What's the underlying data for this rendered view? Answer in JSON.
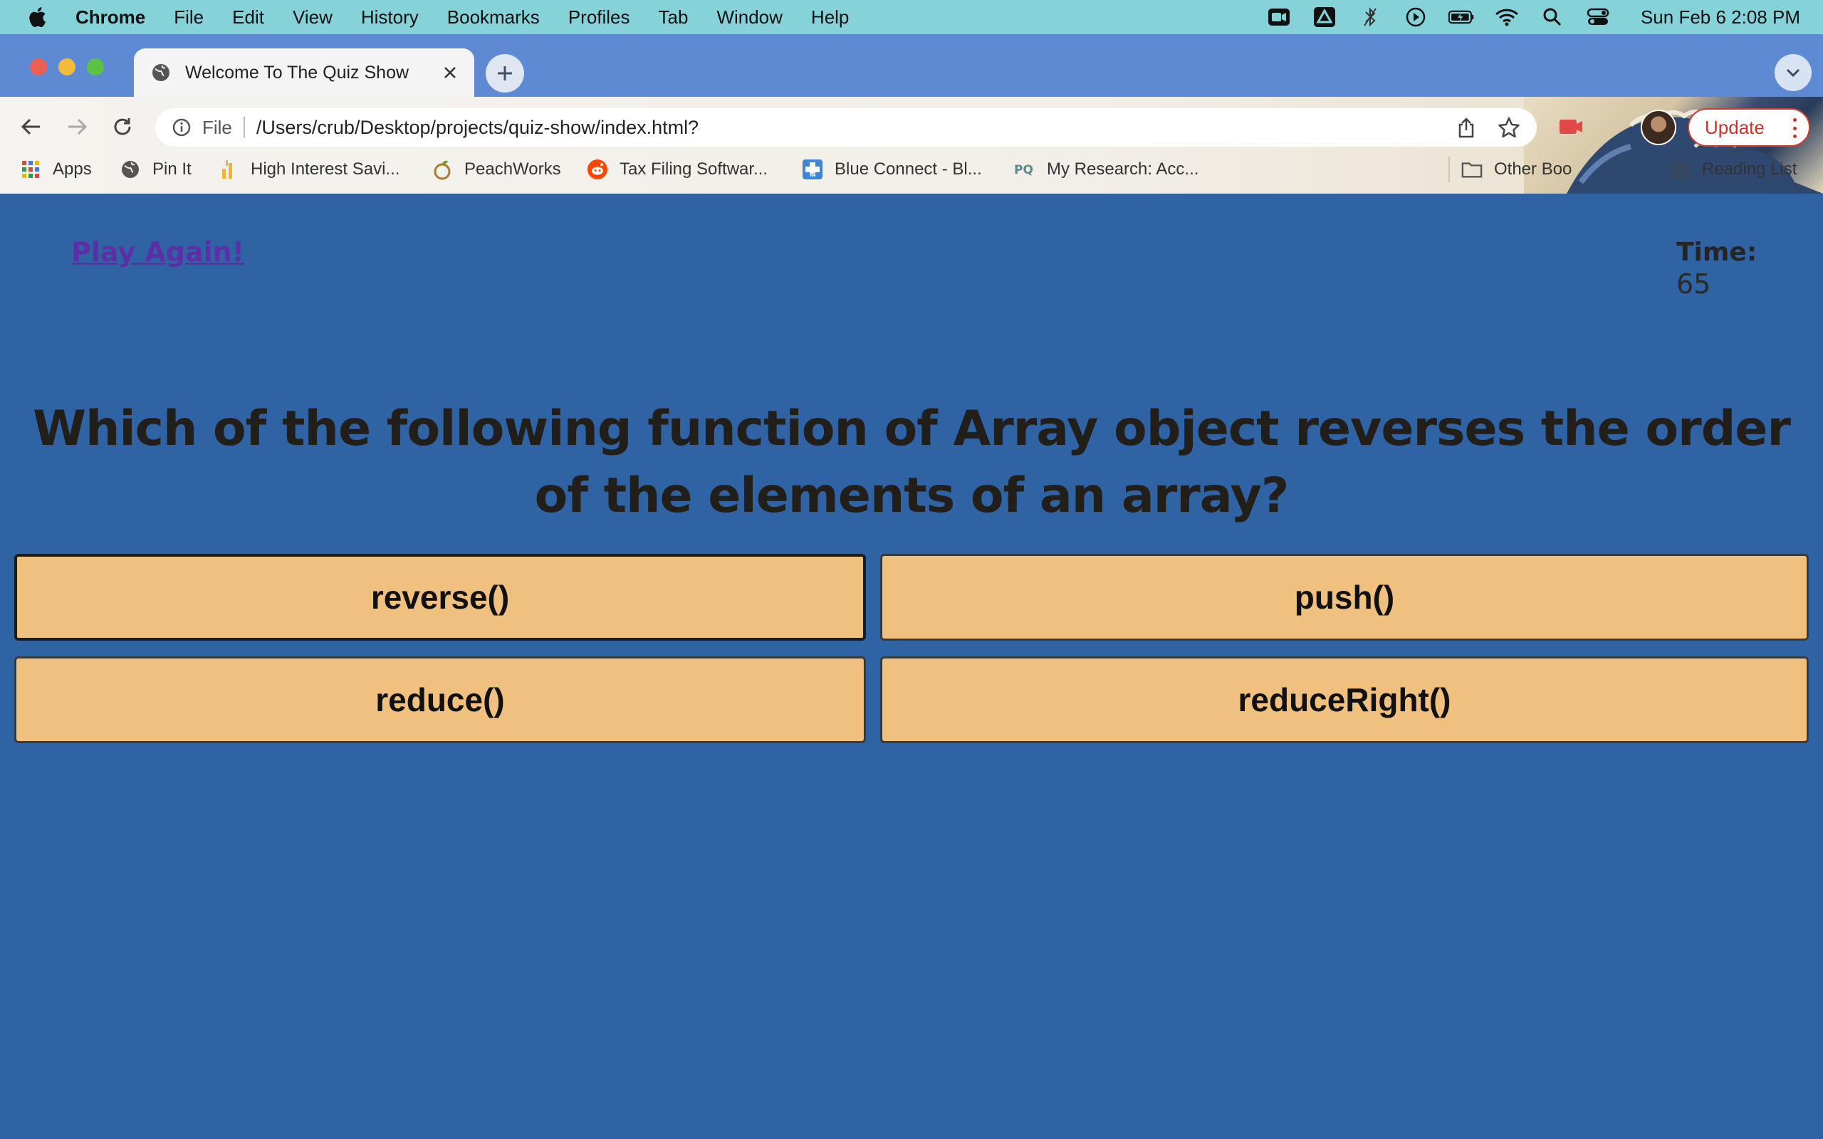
{
  "menubar": {
    "app_name": "Chrome",
    "items": [
      "File",
      "Edit",
      "View",
      "History",
      "Bookmarks",
      "Profiles",
      "Tab",
      "Window",
      "Help"
    ],
    "clock": "Sun Feb 6  2:08 PM"
  },
  "browser": {
    "tab_title": "Welcome To The Quiz Show",
    "omnibox_scheme": "File",
    "url": "/Users/crub/Desktop/projects/quiz-show/index.html?",
    "update_label": "Update",
    "bookmarks": [
      {
        "label": "Apps",
        "icon": "apps-grid-icon"
      },
      {
        "label": "Pin It",
        "icon": "globe-icon"
      },
      {
        "label": "High Interest Savi...",
        "icon": "bank-icon"
      },
      {
        "label": "PeachWorks",
        "icon": "peach-icon"
      },
      {
        "label": "Tax Filing Softwar...",
        "icon": "reddit-icon"
      },
      {
        "label": "Blue Connect - Bl...",
        "icon": "blue-cross-icon"
      },
      {
        "label": "My Research: Acc...",
        "icon": "pq-icon"
      }
    ],
    "other_bookmarks": "Other Boo",
    "reading_list": "Reading List",
    "colors": {
      "tabstrip": "#5d8ad2",
      "update_accent": "#d23b32"
    }
  },
  "quiz": {
    "play_again": "Play Again!",
    "timer_label": "Time:",
    "timer_value": "65",
    "question": "Which of the following function of Array object reverses the order of the elements of an array?",
    "answers": [
      "reverse()",
      "push()",
      "reduce()",
      "reduceRight()"
    ],
    "colors": {
      "background": "#3063a3",
      "answer_fill": "#f0c07f",
      "play_again_link": "#5d2fa6"
    }
  }
}
